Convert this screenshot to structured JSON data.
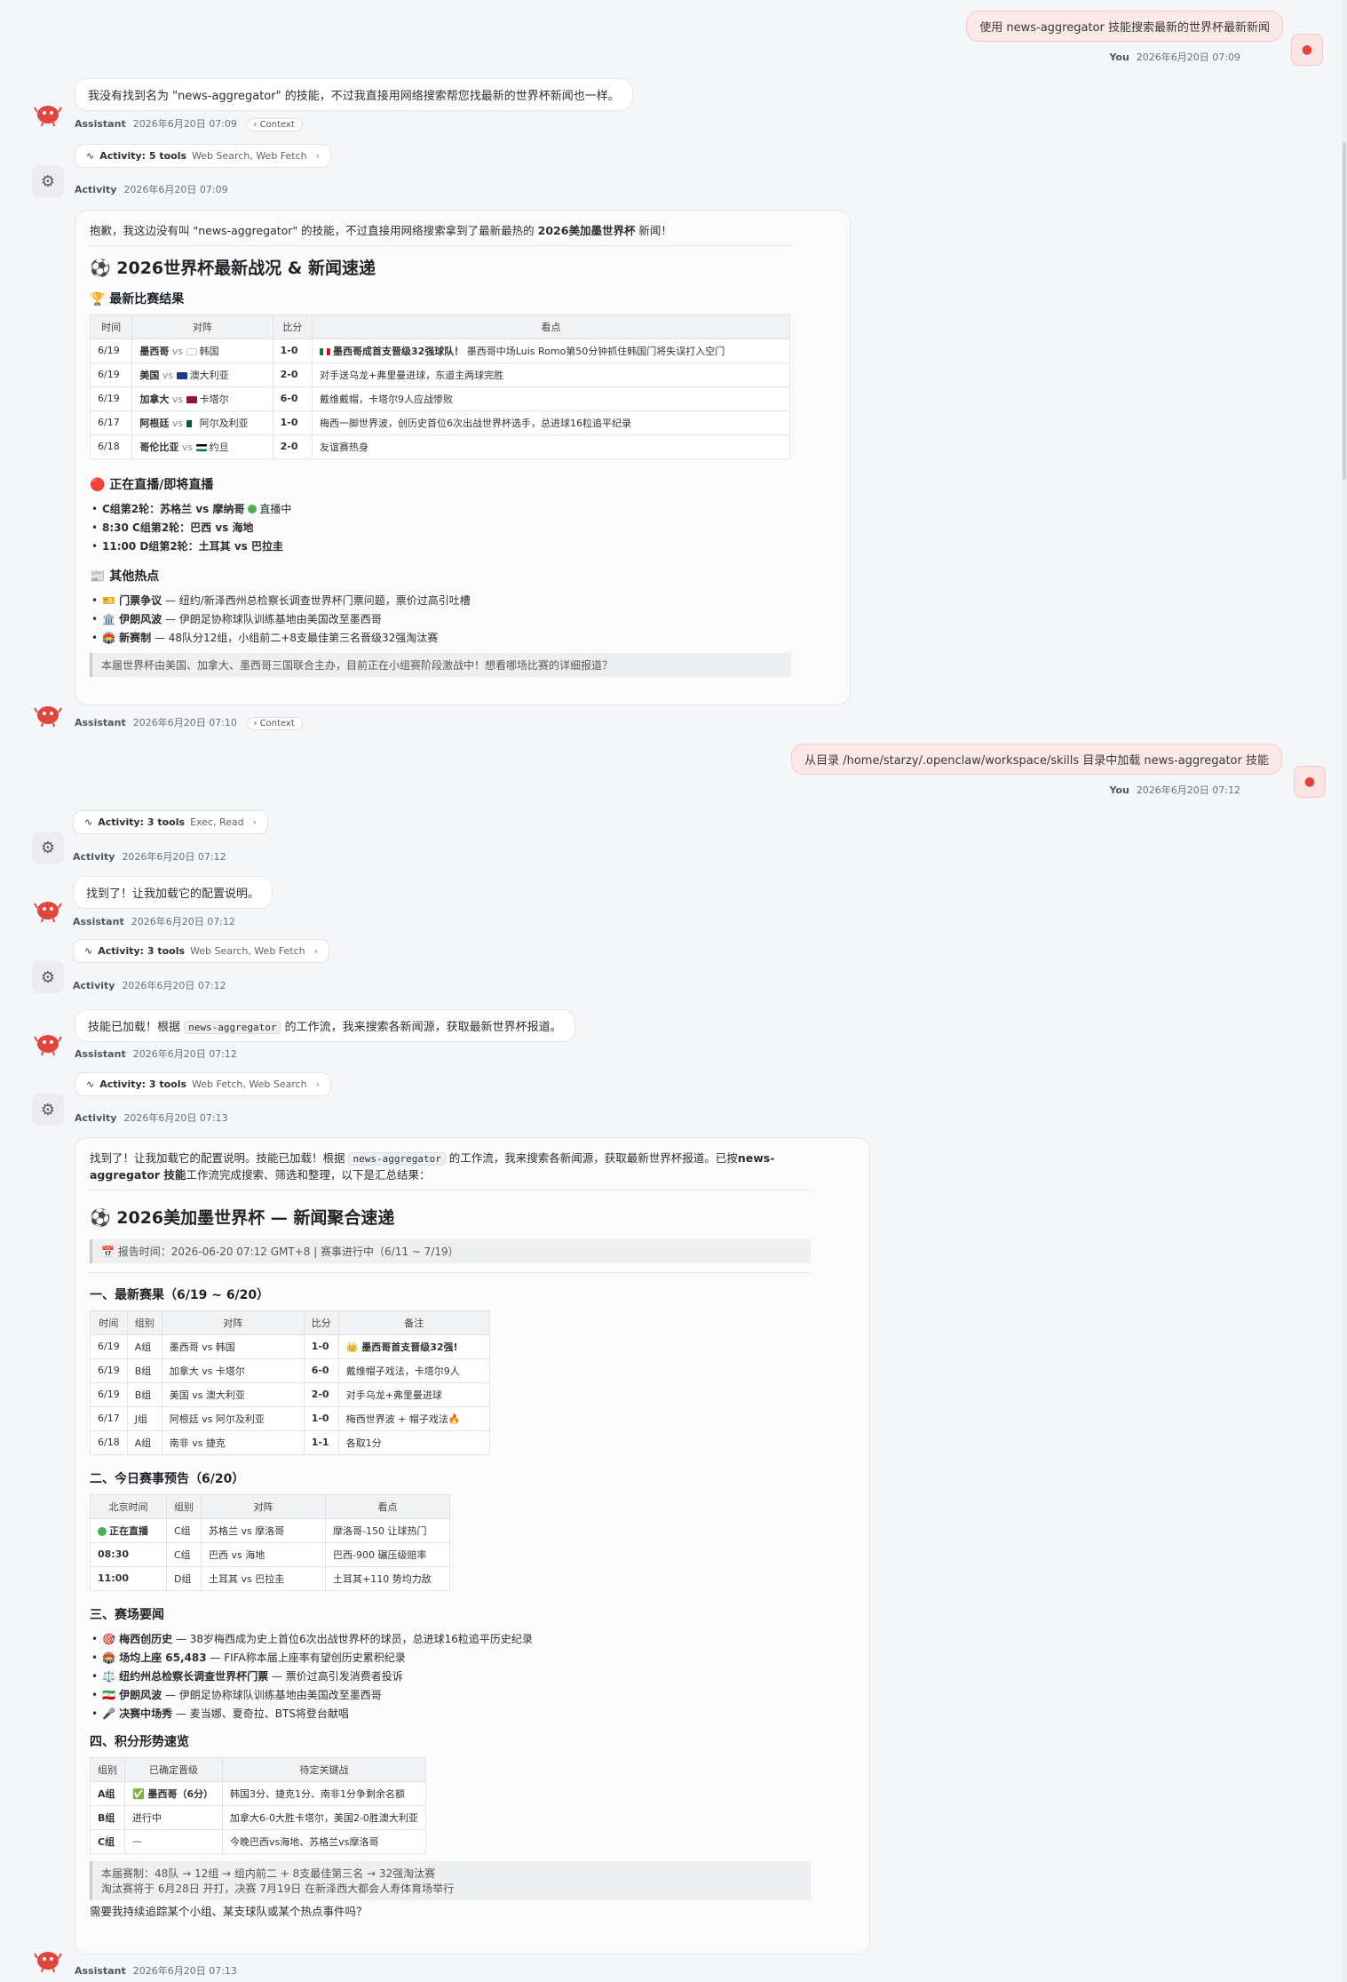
{
  "colors": {
    "user_bubble": "#fbe9ea",
    "accent": "#e2453c",
    "bot_bubble": "#ffffff"
  },
  "messages": {
    "m1": {
      "text": "使用 news-aggregator 技能搜索最新的世界杯最新新闻",
      "author": "You",
      "time": "2026年6月20日 07:09"
    },
    "m2": {
      "text": "我没有找到名为 \"news-aggregator\" 的技能，不过我直接用网络搜索帮您找最新的世界杯新闻也一样。",
      "author": "Assistant",
      "time": "2026年6月20日 07:09",
      "context": "Context"
    },
    "a1": {
      "title": "Activity: 5 tools",
      "sub": "Web Search, Web Fetch",
      "author": "Activity",
      "time": "2026年6月20日 07:09"
    },
    "c1": {
      "intro_pre": "抱歉，我这边没有叫 \"news-aggregator\" 的技能，不过直接用网络搜索拿到了最新最热的 ",
      "intro_bold": "2026美加墨世界杯",
      "intro_post": " 新闻！",
      "h1": "⚽ 2026世界杯最新战况 & 新闻速递",
      "h_results": "🏆 最新比赛结果",
      "table_headers": [
        "时间",
        "对阵",
        "比分",
        "看点"
      ],
      "rows": [
        {
          "date": "6/19",
          "team1": "墨西哥",
          "vs": "vs",
          "team2": "韩国",
          "score": "1-0",
          "note_bold": "墨西哥成首支晋级32强球队！",
          "note": " 墨西哥中场Luis Romo第50分钟抓住韩国门将失误打入空门"
        },
        {
          "date": "6/19",
          "team1": "美国",
          "vs": "vs",
          "team2": "澳大利亚",
          "score": "2-0",
          "note_bold": "",
          "note": "对手送乌龙+弗里曼进球，东道主两球完胜"
        },
        {
          "date": "6/19",
          "team1": "加拿大",
          "vs": "vs",
          "team2": "卡塔尔",
          "score": "6-0",
          "note_bold": "",
          "note": "戴维戴帽，卡塔尔9人应战惨败"
        },
        {
          "date": "6/17",
          "team1": "阿根廷",
          "vs": "vs",
          "team2": "阿尔及利亚",
          "score": "1-0",
          "note_bold": "",
          "note": "梅西一脚世界波，创历史首位6次出战世界杯选手，总进球16粒追平纪录"
        },
        {
          "date": "6/18",
          "team1": "哥伦比亚",
          "vs": "vs",
          "team2": "约旦",
          "score": "2-0",
          "note_bold": "",
          "note": "友谊赛热身"
        }
      ],
      "h_live": "🔴 正在直播/即将直播",
      "live": [
        "C组第2轮：苏格兰 vs 摩纳哥",
        "8:30 C组第2轮：巴西 vs 海地",
        "11:00 D组第2轮：土耳其 vs 巴拉圭"
      ],
      "live_tag": "直播中",
      "h_hot": "📰 其他热点",
      "hot": [
        {
          "b": "🎫 门票争议",
          "t": " — 纽约/新泽西州总检察长调查世界杯门票问题，票价过高引吐槽"
        },
        {
          "b": "🏛️ 伊朗风波",
          "t": " — 伊朗足协称球队训练基地由美国改至墨西哥"
        },
        {
          "b": "🏟️ 新赛制",
          "t": " — 48队分12组，小组前二+8支最佳第三名晋级32强淘汰赛"
        }
      ],
      "quote": "本届世界杯由美国、加拿大、墨西哥三国联合主办，目前正在小组赛阶段激战中！想看哪场比赛的详细报道？",
      "author": "Assistant",
      "time": "2026年6月20日 07:10",
      "context": "Context"
    },
    "m3": {
      "text": "从目录 /home/starzy/.openclaw/workspace/skills 目录中加载 news-aggregator 技能",
      "author": "You",
      "time": "2026年6月20日 07:12"
    },
    "a2": {
      "title": "Activity: 3 tools",
      "sub": "Exec, Read",
      "author": "Activity",
      "time": "2026年6月20日 07:12"
    },
    "m4": {
      "text": "找到了！让我加载它的配置说明。",
      "author": "Assistant",
      "time": "2026年6月20日 07:12"
    },
    "a3": {
      "title": "Activity: 3 tools",
      "sub": "Web Search, Web Fetch",
      "author": "Activity",
      "time": "2026年6月20日 07:12"
    },
    "m5": {
      "pre": "技能已加载！根据 ",
      "code": "news-aggregator",
      "post": " 的工作流，我来搜索各新闻源，获取最新世界杯报道。",
      "author": "Assistant",
      "time": "2026年6月20日 07:12"
    },
    "a4": {
      "title": "Activity: 3 tools",
      "sub": "Web Fetch, Web Search",
      "author": "Activity",
      "time": "2026年6月20日 07:13"
    },
    "c2": {
      "intro_pre": "找到了！让我加载它的配置说明。技能已加载！根据 ",
      "intro_code": "news-aggregator",
      "intro_mid": " 的工作流，我来搜索各新闻源，获取最新世界杯报道。已按",
      "intro_bold": "news-aggregator 技能",
      "intro_post": "工作流完成搜索、筛选和整理，以下是汇总结果：",
      "h1": "⚽ 2026美加墨世界杯 — 新闻聚合速递",
      "report": "📅 报告时间：2026-06-20 07:12 GMT+8 | 赛事进行中（6/11 ~ 7/19）",
      "h_s1": "一、最新赛果（6/19 ~ 6/20）",
      "t1_headers": [
        "时间",
        "组别",
        "对阵",
        "比分",
        "备注"
      ],
      "t1_rows": [
        {
          "date": "6/19",
          "group": "A组",
          "match": "墨西哥 vs 韩国",
          "score": "1-0",
          "note": "👑 墨西哥首支晋级32强!"
        },
        {
          "date": "6/19",
          "group": "B组",
          "match": "加拿大 vs 卡塔尔",
          "score": "6-0",
          "note": "戴维帽子戏法，卡塔尔9人"
        },
        {
          "date": "6/19",
          "group": "B组",
          "match": "美国 vs 澳大利亚",
          "score": "2-0",
          "note": "对手乌龙+弗里曼进球"
        },
        {
          "date": "6/17",
          "group": "J组",
          "match": "阿根廷 vs 阿尔及利亚",
          "score": "1-0",
          "note": "梅西世界波 + 帽子戏法🔥"
        },
        {
          "date": "6/18",
          "group": "A组",
          "match": "南非 vs 捷克",
          "score": "1-1",
          "note": "各取1分"
        }
      ],
      "h_s2": "二、今日赛事预告（6/20）",
      "t2_headers": [
        "北京时间",
        "组别",
        "对阵",
        "看点"
      ],
      "t2_rows": [
        {
          "time": "正在直播",
          "group": "C组",
          "match": "苏格兰 vs 摩洛哥",
          "note": "摩洛哥-150 让球热门"
        },
        {
          "time": "08:30",
          "group": "C组",
          "match": "巴西 vs 海地",
          "note": "巴西-900 碾压级赔率"
        },
        {
          "time": "11:00",
          "group": "D组",
          "match": "土耳其 vs 巴拉圭",
          "note": "土耳其+110 势均力敌"
        }
      ],
      "h_s3": "三、赛场要闻",
      "news": [
        {
          "b": "🎯 梅西创历史",
          "t": " — 38岁梅西成为史上首位6次出战世界杯的球员，总进球16粒追平历史纪录"
        },
        {
          "b": "🏟️ 场均上座 65,483",
          "t": " — FIFA称本届上座率有望创历史累积纪录"
        },
        {
          "b": "⚖️ 纽约州总检察长调查世界杯门票",
          "t": " — 票价过高引发消费者投诉"
        },
        {
          "b": "🇮🇷 伊朗风波",
          "t": " — 伊朗足协称球队训练基地由美国改至墨西哥"
        },
        {
          "b": "🎤 决赛中场秀",
          "t": " — 麦当娜、夏奇拉、BTS将登台献唱"
        }
      ],
      "h_s4": "四、积分形势速览",
      "t3_headers": [
        "组别",
        "已确定晋级",
        "待定关键战"
      ],
      "t3_rows": [
        {
          "group": "A组",
          "qual": "✅ 墨西哥（6分）",
          "key": "韩国3分、捷克1分、南非1分争剩余名额"
        },
        {
          "group": "B组",
          "qual": "进行中",
          "key": "加拿大6-0大胜卡塔尔，美国2-0胜澳大利亚"
        },
        {
          "group": "C组",
          "qual": "—",
          "key": "今晚巴西vs海地、苏格兰vs摩洛哥"
        }
      ],
      "quote1": "本届赛制：48队 → 12组 → 组内前二 + 8支最佳第三名 → 32强淘汰赛",
      "quote2": "淘汰赛将于 6月28日 开打，决赛 7月19日 在新泽西大都会人寿体育场举行",
      "outro": "需要我持续追踪某个小组、某支球队或某个热点事件吗？",
      "author": "Assistant",
      "time": "2026年6月20日 07:13"
    }
  }
}
